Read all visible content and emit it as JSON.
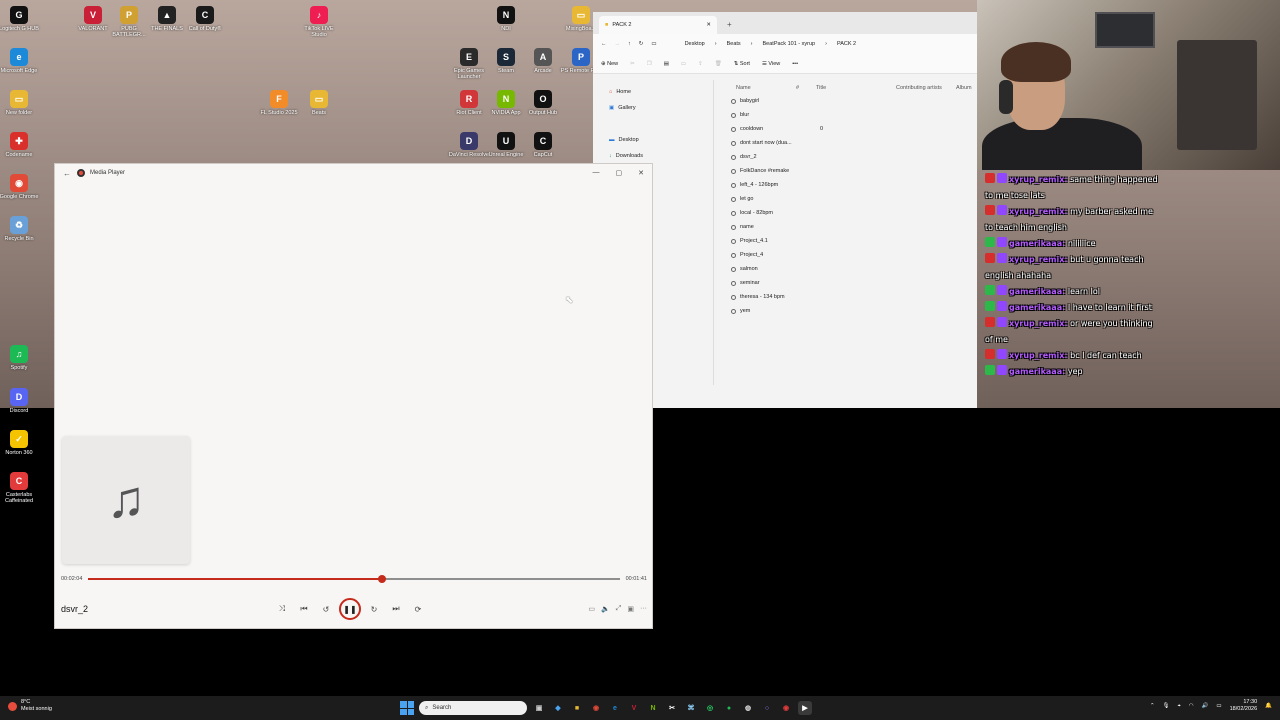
{
  "desktop": {
    "icons": [
      {
        "label": "Logitech G HUB",
        "glyph": "G",
        "color": "#111111"
      },
      {
        "label": "Microsoft Edge",
        "glyph": "e",
        "color": "#1c8ad8"
      },
      {
        "label": "New folder",
        "glyph": "▭",
        "color": "#e8b835"
      },
      {
        "label": "Codename",
        "glyph": "✚",
        "color": "#d9302c"
      },
      {
        "label": "Google Chrome",
        "glyph": "◉",
        "color": "#e04a36"
      },
      {
        "label": "Recycle Bin",
        "glyph": "♻",
        "color": "#6aa0d8"
      },
      {
        "label": "VALORANT",
        "glyph": "V",
        "color": "#c91f37"
      },
      {
        "label": "PUBG BATTLEGR...",
        "glyph": "P",
        "color": "#d1a032"
      },
      {
        "label": "THE FINALS",
        "glyph": "▲",
        "color": "#222222"
      },
      {
        "label": "Call of Duty®",
        "glyph": "C",
        "color": "#1a1a1a"
      },
      {
        "label": "TikTok LIVE Studio",
        "glyph": "♪",
        "color": "#ee1d52"
      },
      {
        "label": "FL Studio 2025",
        "glyph": "F",
        "color": "#f28c28"
      },
      {
        "label": "Beats",
        "glyph": "▭",
        "color": "#e8b835"
      },
      {
        "label": "NDI",
        "glyph": "N",
        "color": "#111111"
      },
      {
        "label": "Epic Games Launcher",
        "glyph": "E",
        "color": "#2a2a2a"
      },
      {
        "label": "Steam",
        "glyph": "S",
        "color": "#1b2838"
      },
      {
        "label": "Arcade",
        "glyph": "A",
        "color": "#555555"
      },
      {
        "label": "PS Remote Play",
        "glyph": "P",
        "color": "#2b66c7"
      },
      {
        "label": "MixingBoa...",
        "glyph": "▭",
        "color": "#e8b835"
      },
      {
        "label": "Riot Client",
        "glyph": "R",
        "color": "#d13639"
      },
      {
        "label": "NVIDIA App",
        "glyph": "N",
        "color": "#76b900"
      },
      {
        "label": "Output Hub",
        "glyph": "O",
        "color": "#111111"
      },
      {
        "label": "DaVinci Resolve",
        "glyph": "D",
        "color": "#3a3a6a"
      },
      {
        "label": "Unreal Engine",
        "glyph": "U",
        "color": "#111111"
      },
      {
        "label": "CapCut",
        "glyph": "C",
        "color": "#111111"
      },
      {
        "label": "Spotify",
        "glyph": "♫",
        "color": "#1db954"
      },
      {
        "label": "Discord",
        "glyph": "D",
        "color": "#5865f2"
      },
      {
        "label": "Norton 360",
        "glyph": "✓",
        "color": "#f5c400"
      },
      {
        "label": "Casterlabs Caffeinated",
        "glyph": "C",
        "color": "#e23b3b"
      }
    ]
  },
  "player": {
    "title": "Media Player",
    "song": "dsvr_2",
    "elapsed": "00:02:04",
    "remaining": "00:01:41",
    "progress": 0.552,
    "accent": "#c42b1c"
  },
  "explorer": {
    "tab_title": "PACK 2",
    "breadcrumbs": [
      "Desktop",
      "Beats",
      "BeatPack 101 - xyrup",
      "PACK 2"
    ],
    "cmd": {
      "new": "New",
      "sort": "Sort",
      "view": "View"
    },
    "nav": [
      "Home",
      "Gallery",
      "Desktop",
      "Downloads"
    ],
    "columns": [
      "Name",
      "#",
      "Title",
      "Contributing artists",
      "Album"
    ],
    "files": [
      {
        "name": "babygirl",
        "num": ""
      },
      {
        "name": "blur",
        "num": ""
      },
      {
        "name": "cooldown",
        "num": "0"
      },
      {
        "name": "dont start now (dua...",
        "num": ""
      },
      {
        "name": "dsvr_2",
        "num": ""
      },
      {
        "name": "FolkDance #remake",
        "num": ""
      },
      {
        "name": "left_4 - 126bpm",
        "num": ""
      },
      {
        "name": "let go",
        "num": ""
      },
      {
        "name": "local - 82bpm",
        "num": ""
      },
      {
        "name": "name",
        "num": ""
      },
      {
        "name": "Project_4.1",
        "num": ""
      },
      {
        "name": "Project_4",
        "num": ""
      },
      {
        "name": "salmon",
        "num": ""
      },
      {
        "name": "seminar",
        "num": ""
      },
      {
        "name": "theresa - 134 bpm",
        "num": ""
      },
      {
        "name": "yem",
        "num": ""
      }
    ]
  },
  "chat": [
    {
      "badge": "#d62d2d",
      "user": "xyrup_remix:",
      "color": "#b45cff",
      "text": "same thing happened to me tose lats"
    },
    {
      "badge": "#d62d2d",
      "user": "xyrup_remix:",
      "color": "#b45cff",
      "text": "my barber asked me to teach him english"
    },
    {
      "badge": "#2db84a",
      "user": "gamerikaaa:",
      "color": "#b45cff",
      "text": "nililiice"
    },
    {
      "badge": "#d62d2d",
      "user": "xyrup_remix:",
      "color": "#b45cff",
      "text": "but u gonna teach english ahahaha"
    },
    {
      "badge": "#2db84a",
      "user": "gamerikaaa:",
      "color": "#b45cff",
      "text": "learn lol"
    },
    {
      "badge": "#2db84a",
      "user": "gamerikaaa:",
      "color": "#b45cff",
      "text": "I have to learn it first"
    },
    {
      "badge": "#d62d2d",
      "user": "xyrup_remix:",
      "color": "#b45cff",
      "text": "or were you thinking of me"
    },
    {
      "badge": "#d62d2d",
      "user": "xyrup_remix:",
      "color": "#b45cff",
      "text": "bc I def can teach"
    },
    {
      "badge": "#2db84a",
      "user": "gamerikaaa:",
      "color": "#b45cff",
      "text": "yep"
    }
  ],
  "taskbar": {
    "weather_temp": "8°C",
    "weather_desc": "Meist sonnig",
    "search_placeholder": "Search",
    "time": "17:30",
    "date": "18/02/2026"
  }
}
